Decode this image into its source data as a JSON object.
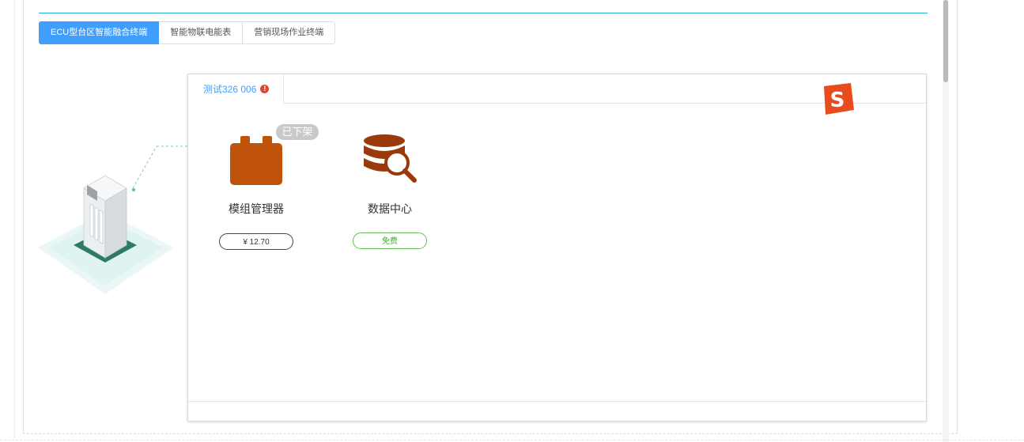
{
  "tabs": [
    {
      "label": "ECU型台区智能融合终端",
      "active": true
    },
    {
      "label": "智能物联电能表",
      "active": false
    },
    {
      "label": "营销现场作业终端",
      "active": false
    }
  ],
  "device_card": {
    "tab_label": "测试326 006",
    "warning_icon": "exclamation-icon",
    "apps": [
      {
        "name": "模组管理器",
        "price": "¥ 12.70",
        "badge": "已下架",
        "icon": "module-manager-icon",
        "icon_color": "#c0530c"
      },
      {
        "name": "数据中心",
        "price": "免费",
        "icon": "database-search-icon",
        "icon_color": "#9a3a0c"
      }
    ]
  },
  "colors": {
    "accent": "#409eff",
    "divider": "#2ab0c6",
    "warning": "#e64330",
    "free": "#4aa33a"
  },
  "floating_icon": "sogou-ime-icon"
}
